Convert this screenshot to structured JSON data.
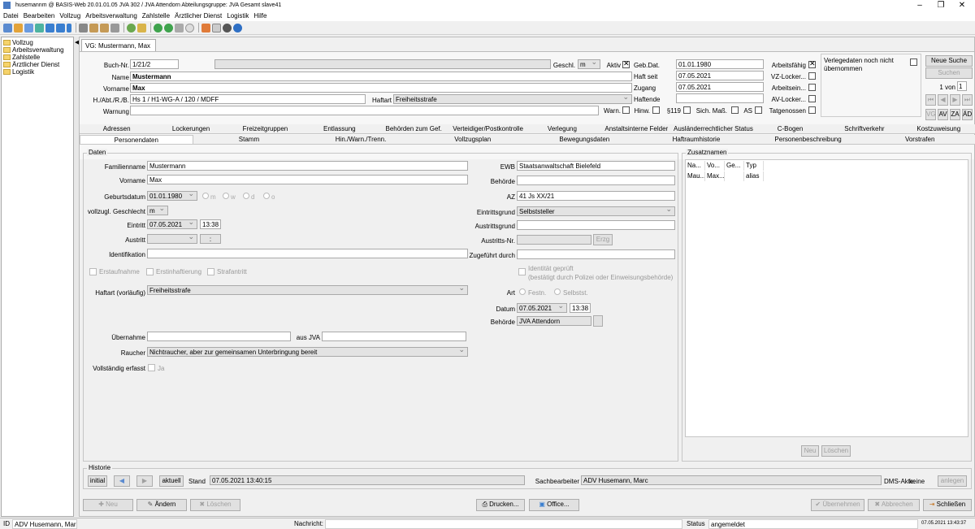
{
  "titlebar": {
    "title": "husemannm @ BASIS-Web 20.01.01.05    JVA 302 / JVA Attendorn    Abteilungsgruppe: JVA Gesamt    slave41"
  },
  "menu": [
    "Datei",
    "Bearbeiten",
    "Vollzug",
    "Arbeitsverwaltung",
    "Zahlstelle",
    "Ärztlicher Dienst",
    "Logistik",
    "Hilfe"
  ],
  "nav": [
    "Vollzug",
    "Arbeitsverwaltung",
    "Zahlstelle",
    "Ärztlicher Dienst",
    "Logistik"
  ],
  "doc_tab": "VG: Mustermann, Max",
  "header": {
    "buch_nr_label": "Buch-Nr.",
    "buch_nr": "1/21/2",
    "name_label": "Name",
    "name": "Mustermann",
    "vorname_label": "Vorname",
    "vorname": "Max",
    "hab_label": "H./Abt./R./B.",
    "hab": "Hs 1 / H1-WG-A / 120 / MDFF",
    "haftart_label": "Haftart",
    "haftart": "Freiheitsstrafe",
    "warnung_label": "Warnung",
    "warnung": "",
    "geschl_label": "Geschl.",
    "geschl": "m",
    "aktiv_label": "Aktiv",
    "geb_dat_label": "Geb.Dat.",
    "geb_dat": "01.01.1980",
    "haft_seit_label": "Haft seit",
    "haft_seit": "07.05.2021",
    "zugang_label": "Zugang",
    "zugang": "07.05.2021",
    "haftende_label": "Haftende",
    "haftende": "",
    "arbeitsfaehig_label": "Arbeitsfähig",
    "vz_locker_label": "VZ-Locker...",
    "arbeitsein_label": "Arbeitsein...",
    "av_locker_label": "AV-Locker...",
    "tatgenossen_label": "Tatgenossen",
    "flags": [
      "Warn.",
      "Hinw.",
      "§119",
      "Sich. Maß.",
      "AS"
    ],
    "verlegedaten": "Verlegedaten noch nicht übernommen",
    "neue_suche": "Neue Suche",
    "suchen": "Suchen",
    "page": "1 von",
    "page_value": "1",
    "small_buttons": [
      "VG",
      "AV",
      "ZA",
      "ÄD"
    ]
  },
  "tabs_row1": [
    "Adressen",
    "Lockerungen",
    "Freizeitgruppen",
    "Entlassung",
    "Behörden zum Gef.",
    "Verteidiger/Postkontrolle",
    "Verlegung",
    "Anstaltsinterne Felder",
    "Ausländerrechtlicher Status",
    "C-Bogen",
    "Schriftverkehr",
    "Kostzuweisung"
  ],
  "tabs_row2": [
    "Personendaten",
    "Stamm",
    "Hin./Warn./Trenn.",
    "Vollzugsplan",
    "Bewegungsdaten",
    "Haftraumhistorie",
    "Personenbeschreibung",
    "Vorstrafen"
  ],
  "daten": {
    "title": "Daten",
    "familienname_label": "Familienname",
    "familienname": "Mustermann",
    "vorname_label": "Vorname",
    "vorname": "Max",
    "geburtsdatum_label": "Geburtsdatum",
    "geburtsdatum": "01.01.1980",
    "gender_options": [
      "m",
      "w",
      "d",
      "o"
    ],
    "geschlecht_label": "vollzugl. Geschlecht",
    "geschlecht": "m",
    "eintritt_label": "Eintritt",
    "eintritt_date": "07.05.2021",
    "eintritt_time": "13:38",
    "austritt_label": "Austritt",
    "austritt_time": ":",
    "identifikation_label": "Identifikation",
    "erstaufnahme": "Erstaufnahme",
    "erstinhaftierung": "Erstinhaftierung",
    "strafantritt": "Strafantritt",
    "haftart_label": "Haftart (vorläufig)",
    "haftart": "Freiheitsstrafe",
    "uebernahme_label": "Übernahme",
    "aus_jva_label": "aus JVA",
    "raucher_label": "Raucher",
    "raucher": "Nichtraucher, aber zur gemeinsamen Unterbringung bereit",
    "vollstaendig_label": "Vollständig erfasst",
    "vollstaendig": "Ja",
    "ewb_label": "EWB",
    "ewb": "Staatsanwaltschaft Bielefeld",
    "behoerde_label": "Behörde",
    "az_label": "AZ",
    "az": "41 Js XX/21",
    "eintrittsgrund_label": "Eintrittsgrund",
    "eintrittsgrund": "Selbststeller",
    "austrittsgrund_label": "Austrittsgrund",
    "austritts_nr_label": "Austritts-Nr.",
    "erzg": "Erzg",
    "zugefuehrt_label": "Zugeführt durch",
    "identitaet": "Identität geprüft",
    "identitaet_sub": "(bestätigt durch Polizei oder Einweisungsbehörde)",
    "art_label": "Art",
    "art_options": [
      "Festn.",
      "Selbstst."
    ],
    "datum_label": "Datum",
    "datum": "07.05.2021",
    "datum_time": "13:38",
    "behoerde2_label": "Behörde",
    "behoerde2": "JVA Attendorn"
  },
  "zusatznamen": {
    "title": "Zusatznamen",
    "headers": [
      "Na...",
      "Vo...",
      "Ge...",
      "Typ"
    ],
    "row": [
      "Mau...",
      "Max...",
      "",
      "alias"
    ],
    "neu": "Neu",
    "loeschen": "Löschen"
  },
  "historie": {
    "title": "Historie",
    "initial": "initial",
    "aktuell": "aktuell",
    "stand_label": "Stand",
    "stand": "07.05.2021 13:40:15",
    "sachbearbeiter_label": "Sachbearbeiter",
    "sachbearbeiter": "ADV Husemann, Marc",
    "dms_label": "DMS-Akte:",
    "dms": "keine",
    "anlegen": "anlegen"
  },
  "actions": {
    "neu": "Neu",
    "aendern": "Ändern",
    "loeschen": "Löschen",
    "drucken": "Drucken...",
    "office": "Office...",
    "uebernehmen": "Übernehmen",
    "abbrechen": "Abbrechen",
    "schliessen": "Schließen"
  },
  "status": {
    "id_label": "ID",
    "id": "ADV Husemann, Marc",
    "nachricht_label": "Nachricht:",
    "status_label": "Status",
    "status": "angemeldet",
    "datetime": "07.05.2021 13:43:37"
  }
}
